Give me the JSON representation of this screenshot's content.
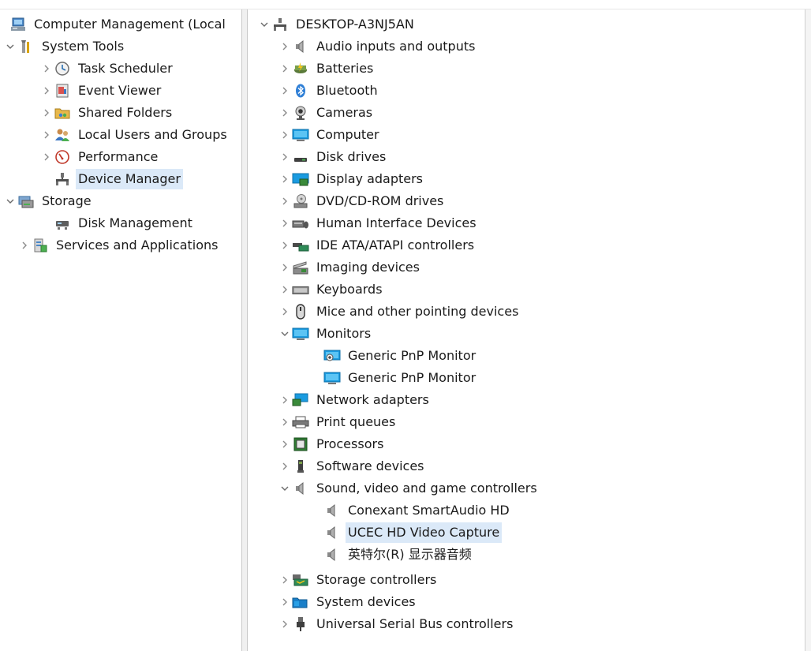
{
  "left_tree": {
    "root": "Computer Management (Local",
    "system_tools": "System Tools",
    "task_scheduler": "Task Scheduler",
    "event_viewer": "Event Viewer",
    "shared_folders": "Shared Folders",
    "local_users": "Local Users and Groups",
    "performance": "Performance",
    "device_manager": "Device Manager",
    "storage": "Storage",
    "disk_management": "Disk Management",
    "services_apps": "Services and Applications"
  },
  "device_tree": {
    "computer_name": "DESKTOP-A3NJ5AN",
    "categories": [
      "Audio inputs and outputs",
      "Batteries",
      "Bluetooth",
      "Cameras",
      "Computer",
      "Disk drives",
      "Display adapters",
      "DVD/CD-ROM drives",
      "Human Interface Devices",
      "IDE ATA/ATAPI controllers",
      "Imaging devices",
      "Keyboards",
      "Mice and other pointing devices",
      "Monitors",
      "Network adapters",
      "Print queues",
      "Processors",
      "Software devices",
      "Sound, video and game controllers",
      "Storage controllers",
      "System devices",
      "Universal Serial Bus controllers"
    ],
    "monitors": [
      "Generic PnP Monitor",
      "Generic PnP Monitor"
    ],
    "sound_devices": [
      "Conexant SmartAudio HD",
      "UCEC HD Video Capture",
      "英特尔(R) 显示器音频"
    ]
  },
  "colors": {
    "selection": "#dbe9f8",
    "accent": "#2f86d6"
  }
}
